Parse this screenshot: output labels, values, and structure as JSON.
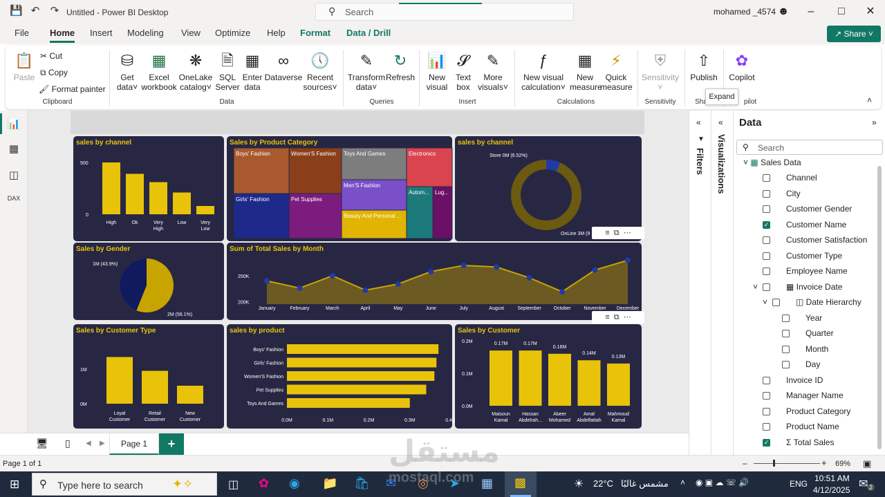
{
  "window": {
    "title": "Untitled - Power BI Desktop",
    "user": "mohamed _4574"
  },
  "search": {
    "placeholder": "Search"
  },
  "menu": {
    "items": [
      "File",
      "Home",
      "Insert",
      "Modeling",
      "View",
      "Optimize",
      "Help",
      "Format",
      "Data / Drill"
    ],
    "share": "Share"
  },
  "ribbon": {
    "clipboard": {
      "paste": "Paste",
      "cut": "Cut",
      "copy": "Copy",
      "format_painter": "Format painter",
      "label": "Clipboard"
    },
    "data": {
      "get_data": [
        "Get",
        "data"
      ],
      "excel": [
        "Excel",
        "workbook"
      ],
      "onelake": [
        "OneLake",
        "catalog"
      ],
      "sql": [
        "SQL",
        "Server"
      ],
      "enter": [
        "Enter",
        "data"
      ],
      "dataverse": "Dataverse",
      "recent": [
        "Recent",
        "sources"
      ],
      "label": "Data"
    },
    "queries": {
      "transform": [
        "Transform",
        "data"
      ],
      "refresh": "Refresh",
      "label": "Queries"
    },
    "insert": {
      "new_visual": [
        "New",
        "visual"
      ],
      "text_box": [
        "Text",
        "box"
      ],
      "more_visuals": [
        "More",
        "visuals"
      ],
      "label": "Insert"
    },
    "calculations": {
      "new_visual_calc": [
        "New visual",
        "calculation"
      ],
      "new_measure": [
        "New",
        "measure"
      ],
      "quick_measure": [
        "Quick",
        "measure"
      ],
      "label": "Calculations"
    },
    "sensitivity": {
      "btn": "Sensitivity",
      "label": "Sensitivity"
    },
    "share": {
      "publish": "Publish",
      "label": "Sha"
    },
    "copilot": {
      "btn": "Copilot",
      "label": "pilot"
    },
    "tooltip": "Expand"
  },
  "panes": {
    "filters": "Filters",
    "visualizations": "Visualizations",
    "data": "Data",
    "data_search": "Search"
  },
  "fields": {
    "table": "Sales Data",
    "items": [
      {
        "name": "Channel",
        "checked": false
      },
      {
        "name": "City",
        "checked": false
      },
      {
        "name": "Customer Gender",
        "checked": false
      },
      {
        "name": "Customer Name",
        "checked": true
      },
      {
        "name": "Customer Satisfaction",
        "checked": false
      },
      {
        "name": "Customer Type",
        "checked": false
      },
      {
        "name": "Employee Name",
        "checked": false
      },
      {
        "name": "Invoice Date",
        "checked": false
      },
      {
        "name": "Date Hierarchy",
        "checked": false
      },
      {
        "name": "Year",
        "checked": false
      },
      {
        "name": "Quarter",
        "checked": false
      },
      {
        "name": "Month",
        "checked": false
      },
      {
        "name": "Day",
        "checked": false
      },
      {
        "name": "Invoice ID",
        "checked": false
      },
      {
        "name": "Manager Name",
        "checked": false
      },
      {
        "name": "Product Category",
        "checked": false
      },
      {
        "name": "Product Name",
        "checked": false
      },
      {
        "name": "Total Sales",
        "checked": true
      }
    ]
  },
  "pages": {
    "tab": "Page 1",
    "status": "Page 1 of 1",
    "zoom": "69%"
  },
  "taskbar": {
    "search_placeholder": "Type here to search",
    "weather": "22°C",
    "weather_text": "مشمس غالبًا",
    "lang": "ENG",
    "time": "10:51 AM",
    "date": "4/12/2025",
    "notif": "2",
    "watermark": "mostaql.com",
    "watermark_ar": "مستقل"
  },
  "colors": {
    "accent": "#117865",
    "tile": "#272744",
    "gold": "#e8c30a"
  },
  "chart_data": [
    {
      "type": "bar",
      "title": "sales by channel",
      "categories": [
        "High",
        "Ok",
        "Very High",
        "Low",
        "Very Low"
      ],
      "values": [
        500,
        390,
        310,
        210,
        80
      ],
      "yticks": [
        "500",
        "0"
      ],
      "ylim": [
        0,
        600
      ]
    },
    {
      "type": "treemap",
      "title": "Sales by Product Category",
      "categories": [
        "Boys' Fashion",
        "Women'S Fashion",
        "Toys And Games",
        "Electronics",
        "Girls' Fashion",
        "Pet Supplies",
        "Men'S Fashion",
        "Autom...",
        "Lug...",
        "Beauty And Personal ..."
      ]
    },
    {
      "type": "pie",
      "title": "sales by channel",
      "labels": [
        "Store 0M (6.52%)",
        "OnLine 3M (9"
      ],
      "values": [
        6.52,
        93.48
      ]
    },
    {
      "type": "pie",
      "title": "Sales by Gender",
      "labels": [
        "1M (43.9%)",
        "2M (56.1%)"
      ],
      "values": [
        43.9,
        56.1
      ]
    },
    {
      "type": "area",
      "title": "Sum of Total Sales by Month",
      "categories": [
        "January",
        "February",
        "March",
        "April",
        "May",
        "June",
        "July",
        "August",
        "September",
        "October",
        "November",
        "December"
      ],
      "values": [
        240,
        226,
        250,
        222,
        234,
        258,
        270,
        267,
        246,
        219,
        261,
        280
      ],
      "yticks": [
        "250K",
        "200K"
      ],
      "ylim": [
        195,
        290
      ]
    },
    {
      "type": "bar",
      "title": "Sales by Customer Type",
      "categories": [
        "Loyal Customer",
        "Retail Customer",
        "New Customer"
      ],
      "values": [
        1.35,
        0.95,
        0.52
      ],
      "yticks": [
        "1M",
        "0M"
      ],
      "ylim": [
        0,
        1.6
      ]
    },
    {
      "type": "hbar",
      "title": "sales by product",
      "categories": [
        "Boys' Fashion",
        "Girls' Fashion",
        "Women'S Fashion",
        "Pet Supplies",
        "Toys And Games"
      ],
      "values": [
        0.37,
        0.365,
        0.36,
        0.34,
        0.3
      ],
      "xticks": [
        "0.0M",
        "0.1M",
        "0.2M",
        "0.3M",
        "0.4M"
      ],
      "xlim": [
        0,
        0.4
      ]
    },
    {
      "type": "bar",
      "title": "Sales by Customer",
      "categories": [
        "Maisoun Kamal",
        "Hassan Abdelrah...",
        "Abeer Mohamed",
        "Amal Abdelfattah",
        "Mahmoud Kamal"
      ],
      "values": [
        0.17,
        0.17,
        0.16,
        0.14,
        0.13
      ],
      "labels": [
        "0.17M",
        "0.17M",
        "0.16M",
        "0.14M",
        "0.13M"
      ],
      "yticks": [
        "0.2M",
        "0.1M",
        "0.0M"
      ],
      "ylim": [
        0,
        0.2
      ]
    }
  ]
}
